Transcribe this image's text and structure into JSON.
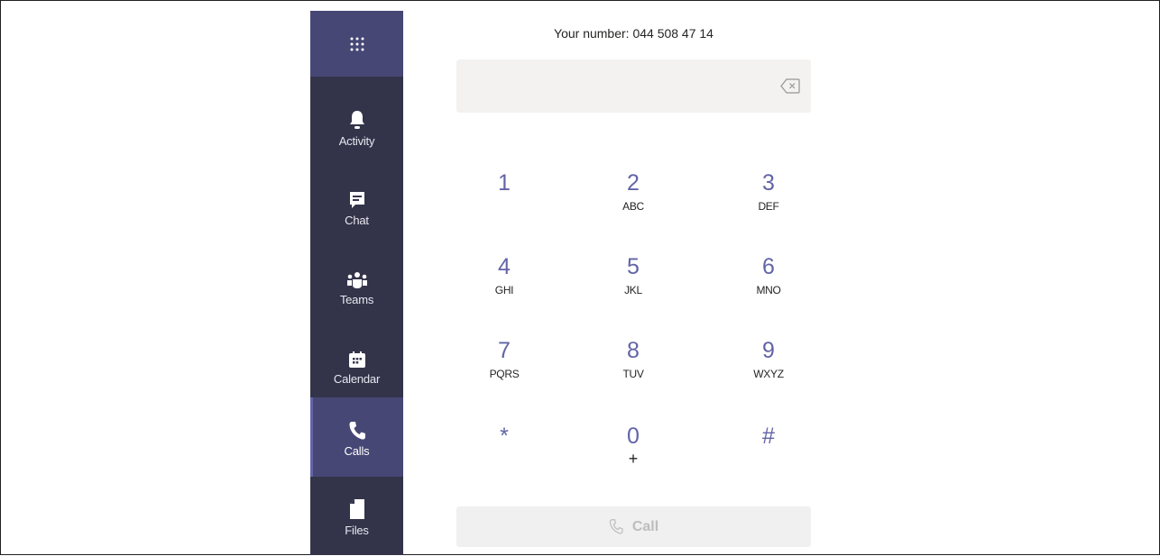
{
  "rail": {
    "apps_icon": "waffle-icon",
    "items": [
      {
        "label": "Activity",
        "icon": "bell-icon"
      },
      {
        "label": "Chat",
        "icon": "chat-icon"
      },
      {
        "label": "Teams",
        "icon": "teams-icon"
      },
      {
        "label": "Calendar",
        "icon": "calendar-icon"
      },
      {
        "label": "Calls",
        "icon": "phone-icon",
        "active": true
      },
      {
        "label": "Files",
        "icon": "file-icon"
      }
    ]
  },
  "dialer": {
    "your_number": "Your number: 044 508 47 14",
    "input_value": "",
    "keys": [
      {
        "digit": "1",
        "letters": ""
      },
      {
        "digit": "2",
        "letters": "ABC"
      },
      {
        "digit": "3",
        "letters": "DEF"
      },
      {
        "digit": "4",
        "letters": "GHI"
      },
      {
        "digit": "5",
        "letters": "JKL"
      },
      {
        "digit": "6",
        "letters": "MNO"
      },
      {
        "digit": "7",
        "letters": "PQRS"
      },
      {
        "digit": "8",
        "letters": "TUV"
      },
      {
        "digit": "9",
        "letters": "WXYZ"
      },
      {
        "digit": "*",
        "letters": ""
      },
      {
        "digit": "0",
        "letters": "+"
      },
      {
        "digit": "#",
        "letters": ""
      }
    ],
    "call_label": "Call"
  },
  "colors": {
    "rail_bg": "#33344a",
    "rail_active": "#464775",
    "accent": "#6264a7",
    "input_bg": "#f3f2f1"
  }
}
